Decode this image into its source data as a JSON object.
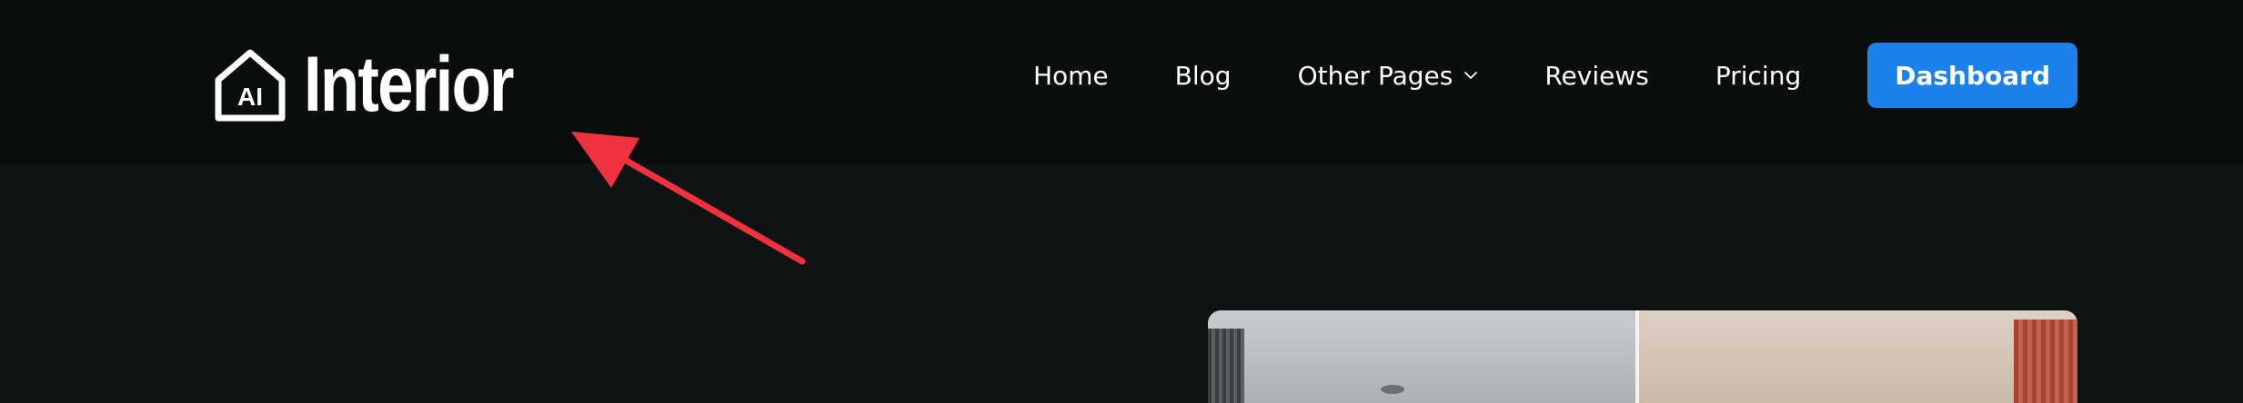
{
  "header": {
    "logo": {
      "icon_text": "AI",
      "brand_text": "Interior",
      "icon": "house-icon"
    },
    "nav": {
      "items": [
        {
          "label": "Home"
        },
        {
          "label": "Blog"
        },
        {
          "label": "Other Pages",
          "icon": "chevron-down-icon"
        },
        {
          "label": "Reviews"
        },
        {
          "label": "Pricing"
        }
      ],
      "cta_label": "Dashboard"
    }
  },
  "annotation": {
    "arrow_color": "#f0323f",
    "icon": "red-arrow-annotation"
  },
  "hero": {
    "image": "before-after-interior-image"
  },
  "colors": {
    "header_bg": "#0a0d0e",
    "page_bg": "#0f1314",
    "accent": "#1a82ea",
    "text": "#ffffff"
  }
}
